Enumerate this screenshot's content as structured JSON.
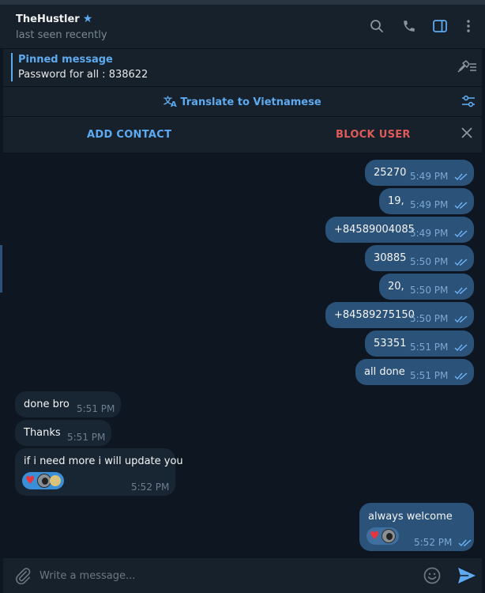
{
  "header": {
    "name": "TheHustler",
    "status": "last seen recently",
    "icons": [
      "search-icon",
      "phone-icon",
      "sidebar-toggle-icon",
      "more-vert-icon"
    ]
  },
  "pinned": {
    "title": "Pinned message",
    "text": "Password for all : 838622"
  },
  "translate": {
    "label": "Translate to Vietnamese"
  },
  "actions": {
    "add_contact": "ADD CONTACT",
    "block_user": "BLOCK USER"
  },
  "messages": [
    {
      "dir": "out",
      "text": "25270",
      "time": "5:49 PM"
    },
    {
      "dir": "out",
      "text": "19,",
      "time": "5:49 PM"
    },
    {
      "dir": "out",
      "text": "+84589004085",
      "time": "5:49 PM"
    },
    {
      "dir": "out",
      "text": "30885",
      "time": "5:50 PM"
    },
    {
      "dir": "out",
      "text": "20,",
      "time": "5:50 PM"
    },
    {
      "dir": "out",
      "text": "+84589275150",
      "time": "5:50 PM"
    },
    {
      "dir": "out",
      "text": "53351",
      "time": "5:51 PM"
    },
    {
      "dir": "out",
      "text": "all done",
      "time": "5:51 PM"
    },
    {
      "dir": "in",
      "text": "done bro",
      "time": "5:51 PM"
    },
    {
      "dir": "in",
      "text": "Thanks",
      "time": "5:51 PM"
    },
    {
      "dir": "in",
      "text": "if i need more i will update you",
      "time": "5:52 PM"
    },
    {
      "dir": "out",
      "text": "always welcome",
      "time": "5:52 PM"
    }
  ],
  "composer": {
    "placeholder": "Write a message..."
  },
  "colors": {
    "accent": "#5eaaf0",
    "outgoing_bubble": "#2b5278",
    "incoming_bubble": "#182533",
    "danger": "#e05a5a",
    "background": "#0e1621"
  }
}
